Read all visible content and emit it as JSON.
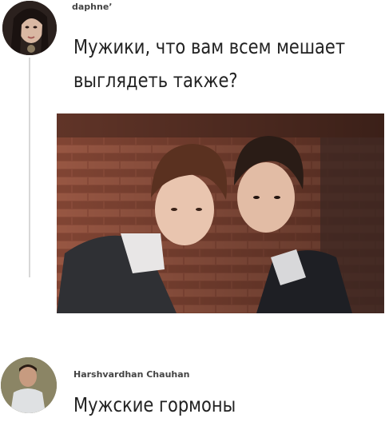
{
  "post": {
    "author": "daphneʼ",
    "text_line1": "Мужики, что вам всем мешает",
    "text_line2": "выглядеть также?"
  },
  "reply": {
    "author": "Harshvardhan Chauhan",
    "text": "Мужские гормоны"
  },
  "colors": {
    "brick": "#8a4a36",
    "text": "#222222",
    "thread_line": "#d8d8d8"
  }
}
